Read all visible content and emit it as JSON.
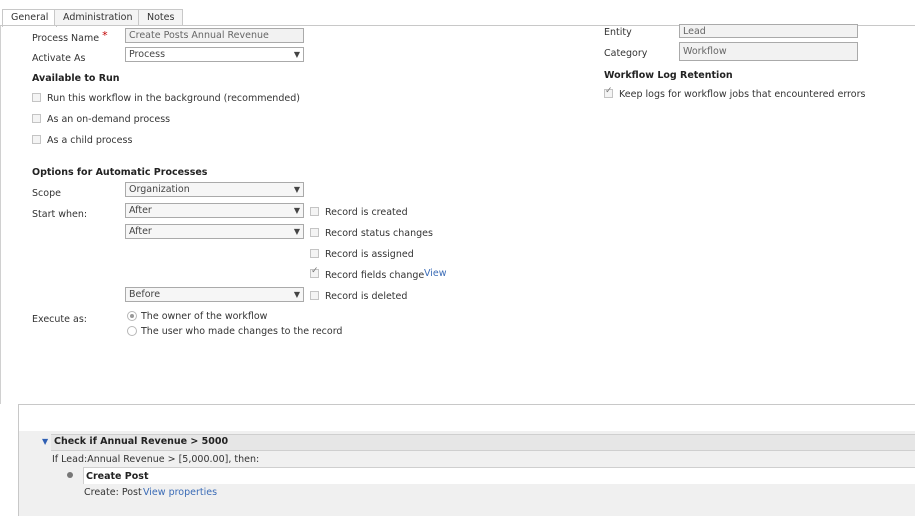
{
  "tabs": [
    "General",
    "Administration",
    "Notes"
  ],
  "form": {
    "process_name_label": "Process Name",
    "required_mark": "*",
    "process_name_value": "Create Posts Annual Revenue",
    "activate_as_label": "Activate As",
    "activate_as_value": "Process",
    "available_heading": "Available to Run",
    "run_background": "Run this workflow in the background (recommended)",
    "on_demand": "As an on-demand process",
    "child_process": "As a child process",
    "options_heading": "Options for Automatic Processes",
    "scope_label": "Scope",
    "scope_value": "Organization",
    "start_when_label": "Start when:",
    "start_select_1": "After",
    "start_select_2": "After",
    "start_select_3": "Before",
    "record_created": "Record is created",
    "record_status": "Record status changes",
    "record_assigned": "Record is assigned",
    "record_fields": "Record fields change",
    "view_link": "View",
    "record_deleted": "Record is deleted",
    "execute_as_label": "Execute as:",
    "owner_option": "The owner of the workflow",
    "user_option": "The user who made changes to the record"
  },
  "right": {
    "entity_label": "Entity",
    "entity_value": "Lead",
    "category_label": "Category",
    "category_value": "Workflow",
    "log_heading": "Workflow Log Retention",
    "keep_logs": "Keep logs for workflow jobs that encountered errors"
  },
  "steps": {
    "condition_title": "Check if Annual Revenue > 5000",
    "condition_text": "If Lead:Annual Revenue > [5,000.00], then:",
    "action_title": "Create Post",
    "action_prefix": "Create:",
    "action_entity": "Post",
    "view_properties": "View properties"
  },
  "checkbox_state": {
    "run_background": false,
    "on_demand": false,
    "child_process": false,
    "record_created": false,
    "record_status": false,
    "record_assigned": false,
    "record_fields": true,
    "record_deleted": false,
    "keep_logs": true
  },
  "colors": {
    "link": "#3a6bb6",
    "required": "#c00000",
    "tree_arrow": "#2f5fb3"
  }
}
